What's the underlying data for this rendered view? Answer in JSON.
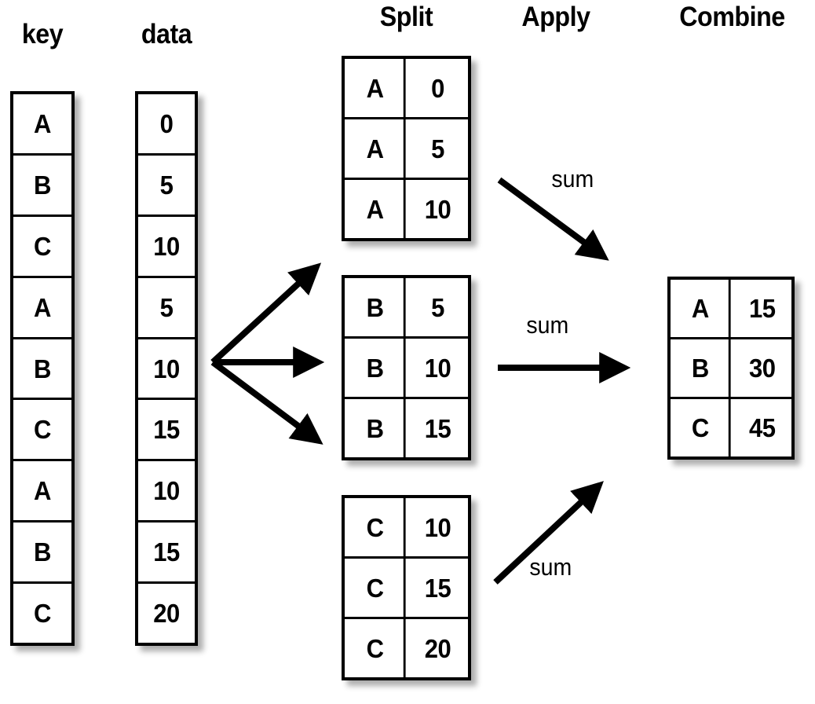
{
  "headings": {
    "key": "key",
    "data": "data",
    "split": "Split",
    "apply": "Apply",
    "combine": "Combine"
  },
  "colors": {
    "line": "#000000",
    "background": "#ffffff",
    "shadow": "rgba(0,0,0,0.32)"
  },
  "key_column": {
    "label": "key",
    "values": [
      "A",
      "B",
      "C",
      "A",
      "B",
      "C",
      "A",
      "B",
      "C"
    ]
  },
  "data_column": {
    "label": "data",
    "values": [
      "0",
      "5",
      "10",
      "5",
      "10",
      "15",
      "10",
      "15",
      "20"
    ]
  },
  "split_tables": [
    {
      "group": "A",
      "rows": [
        {
          "key": "A",
          "value": "0"
        },
        {
          "key": "A",
          "value": "5"
        },
        {
          "key": "A",
          "value": "10"
        }
      ]
    },
    {
      "group": "B",
      "rows": [
        {
          "key": "B",
          "value": "5"
        },
        {
          "key": "B",
          "value": "10"
        },
        {
          "key": "B",
          "value": "15"
        }
      ]
    },
    {
      "group": "C",
      "rows": [
        {
          "key": "C",
          "value": "10"
        },
        {
          "key": "C",
          "value": "15"
        },
        {
          "key": "C",
          "value": "20"
        }
      ]
    }
  ],
  "apply_arrows": [
    {
      "label": "sum",
      "from_group": "A"
    },
    {
      "label": "sum",
      "from_group": "B"
    },
    {
      "label": "sum",
      "from_group": "C"
    }
  ],
  "combine_table": {
    "rows": [
      {
        "key": "A",
        "value": "15"
      },
      {
        "key": "B",
        "value": "30"
      },
      {
        "key": "C",
        "value": "45"
      }
    ]
  }
}
